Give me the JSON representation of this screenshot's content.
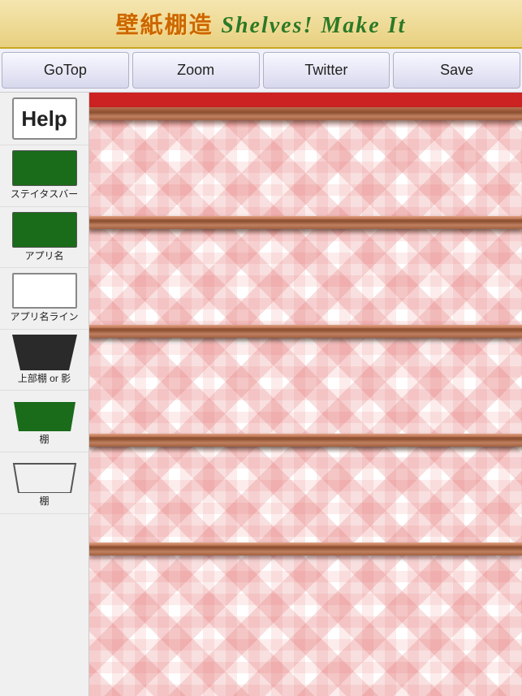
{
  "header": {
    "title_japanese": "壁紙棚造",
    "title_english": "Shelves! Make It"
  },
  "toolbar": {
    "buttons": [
      {
        "id": "gotop",
        "label": "GoTop"
      },
      {
        "id": "zoom",
        "label": "Zoom"
      },
      {
        "id": "twitter",
        "label": "Twitter"
      },
      {
        "id": "save",
        "label": "Save"
      }
    ]
  },
  "sidebar": {
    "items": [
      {
        "id": "help",
        "label": "Help",
        "type": "help"
      },
      {
        "id": "status-bar",
        "label": "ステイタスバー",
        "type": "dark-green"
      },
      {
        "id": "app-name",
        "label": "アプリ名",
        "type": "dark-green2"
      },
      {
        "id": "app-name-line",
        "label": "アプリ名ライン",
        "type": "white-box"
      },
      {
        "id": "top-shelf",
        "label": "上部棚 or 影",
        "type": "trapezoid-dark"
      },
      {
        "id": "shelf1",
        "label": "棚",
        "type": "trapezoid-green"
      },
      {
        "id": "shelf2",
        "label": "棚",
        "type": "trapezoid-outline"
      }
    ]
  },
  "canvas": {
    "shelf_count": 5
  }
}
